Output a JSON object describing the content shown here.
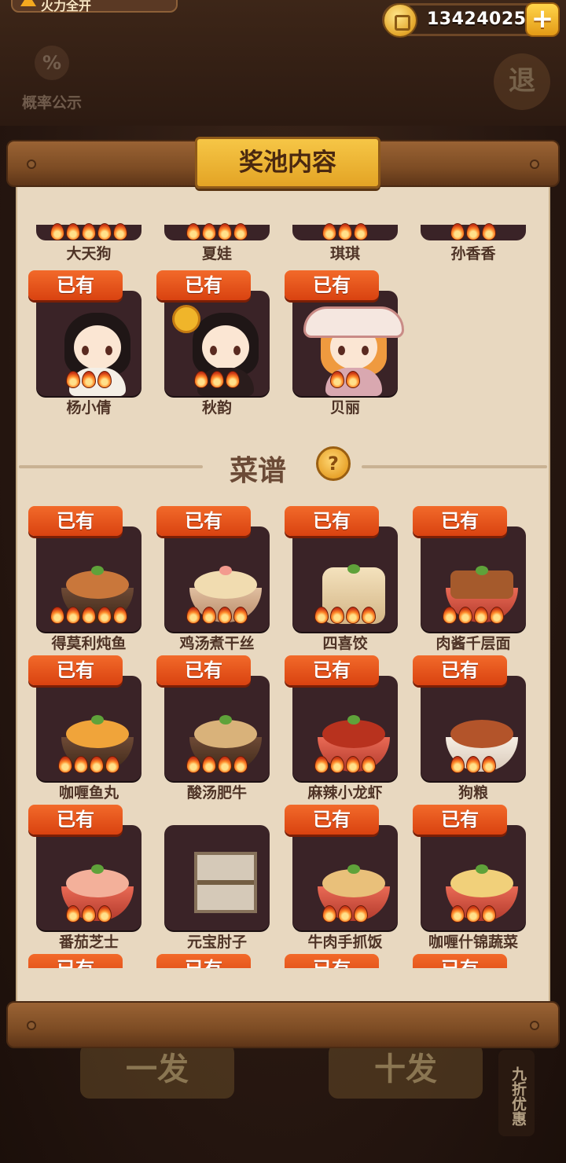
{
  "header": {
    "top_left_label": "火力全开",
    "coins": "13424025",
    "plus_symbol": "+",
    "probability_icon": "%",
    "probability_label": "概率公示",
    "exit_label": "退"
  },
  "panel": {
    "title": "奖池内容",
    "owned_label": "已有"
  },
  "characters_partial": [
    "大天狗",
    "夏娃",
    "琪琪",
    "孙香香"
  ],
  "characters": [
    {
      "name": "杨小倩",
      "owned": true,
      "stars": 3
    },
    {
      "name": "秋韵",
      "owned": true,
      "stars": 3
    },
    {
      "name": "贝丽",
      "owned": true,
      "stars": 2
    }
  ],
  "recipes_section": {
    "label": "菜谱",
    "help_icon": "?"
  },
  "recipes": [
    {
      "name": "得莫利炖鱼",
      "owned": true,
      "stars": 5
    },
    {
      "name": "鸡汤煮干丝",
      "owned": true,
      "stars": 4
    },
    {
      "name": "四喜饺",
      "owned": true,
      "stars": 4
    },
    {
      "name": "肉酱千层面",
      "owned": true,
      "stars": 4
    },
    {
      "name": "咖喱鱼丸",
      "owned": true,
      "stars": 4
    },
    {
      "name": "酸汤肥牛",
      "owned": true,
      "stars": 4
    },
    {
      "name": "麻辣小龙虾",
      "owned": true,
      "stars": 4
    },
    {
      "name": "狗粮",
      "owned": true,
      "stars": 3
    },
    {
      "name": "番茄芝士",
      "owned": true,
      "stars": 3
    },
    {
      "name": "元宝肘子",
      "owned": false,
      "stars": 0
    },
    {
      "name": "牛肉手抓饭",
      "owned": true,
      "stars": 3
    },
    {
      "name": "咖喱什锦蔬菜",
      "owned": true,
      "stars": 3
    }
  ],
  "bottom": {
    "single_draw": "一发",
    "ten_draw": "十发",
    "discount": "九折优惠"
  }
}
